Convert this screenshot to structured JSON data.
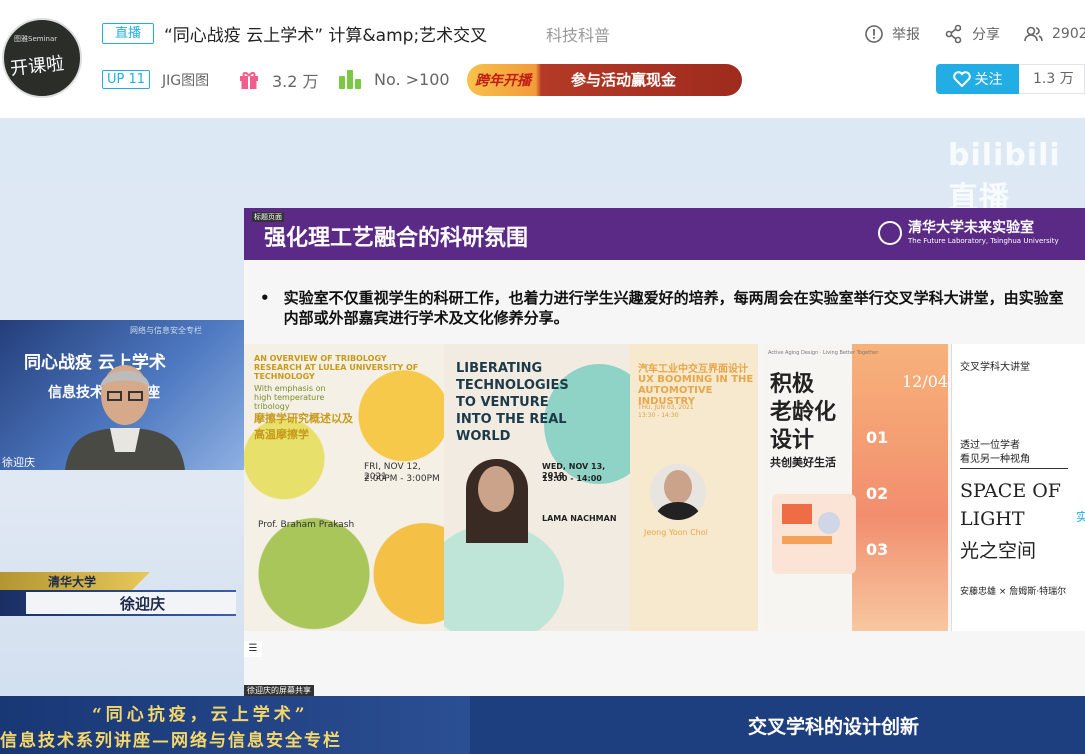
{
  "header": {
    "avatar_text_top": "图雅Seminar",
    "avatar_text_main": "开课啦",
    "live_tag": "直播",
    "title": "“同心战疫 云上学术” 计算&amp;艺术交叉",
    "category": "科技科普",
    "report_label": "举报",
    "share_label": "分享",
    "viewers": "2902",
    "up_level": "UP 11",
    "host_name": "JIG图图",
    "gifts": "3.2 万",
    "rank": "No. >100",
    "banner_left": "跨年开播",
    "banner_right": "参与活动赢现金",
    "follow_label": "关注",
    "follower_count": "1.3 万"
  },
  "stage": {
    "watermark": "bilibili直播",
    "camera": {
      "title1": "同心战疫  云上学术",
      "title2": "信息技术系列讲座",
      "top_small": "网络与信息安全专栏",
      "name_overlay": "徐迎庆"
    },
    "nameplate": {
      "org": "清华大学",
      "name": "徐迎庆"
    },
    "slide": {
      "corner_tag": "标题页面",
      "heading": "强化理工艺融合的科研氛围",
      "logo_cn": "清华大学未来实验室",
      "logo_en": "The Future Laboratory, Tsinghua University",
      "bullet": "实验室不仅重视学生的科研工作，也着力进行学生兴趣爱好的培养，每两周会在实验室举行交叉学科大讲堂，由实验室内部或外部嘉宾进行学术及文化修养分享。",
      "posters": {
        "p1_title": "AN OVERVIEW OF TRIBOLOGY RESEARCH AT LULEA UNIVERSITY OF TECHNOLOGY",
        "p1_sub": "With emphasis on high temperature tribology",
        "p1_cn": "摩擦学研究概述以及高温摩擦学",
        "p1_date": "FRI, NOV 12, 2021",
        "p1_time": "2:00PM - 3:00PM",
        "p1_speaker": "Prof. Braham Prakash",
        "p2_title": "LIBERATING TECHNOLOGIES TO VENTURE INTO THE REAL WORLD",
        "p2_date": "WED, NOV 13, 2019",
        "p2_time": "13:00 - 14:00",
        "p2_speaker": "LAMA NACHMAN",
        "p3_cn": "汽车工业中交互界面设计",
        "p3_en": "UX BOOMING IN THE AUTOMOTIVE INDUSTRY",
        "p3_date": "THU, JUN 03, 2021",
        "p3_time": "13:30 - 14:30",
        "p3_speaker": "Jeong Yoon Choi",
        "p4_top": "Active Aging Design · Living Better Together",
        "p4_title1": "积极",
        "p4_title2": "老龄化",
        "p4_title3": "设计",
        "p4_sub": "共创美好生活",
        "p4_date": "12/04",
        "p4_n1": "01",
        "p4_n2": "02",
        "p4_n3": "03",
        "p5_top": "交叉学科大讲堂",
        "p5_line1": "透过一位学者",
        "p5_line2": "看见另一种视角",
        "p5_en1": "SPACE OF",
        "p5_en2": "LIGHT",
        "p5_cn": "光之空间",
        "p5_names": "安藤忠雄 × 詹姆斯·特瑞尔"
      }
    },
    "screen_share_label": "徐迎庆的屏幕共享",
    "menu_icon": "☰",
    "side_text": "实"
  },
  "caption": {
    "line1": "“同心抗疫，云上学术”",
    "line2": "信息技术系列讲座—网络与信息安全专栏",
    "right": "交叉学科的设计创新"
  }
}
